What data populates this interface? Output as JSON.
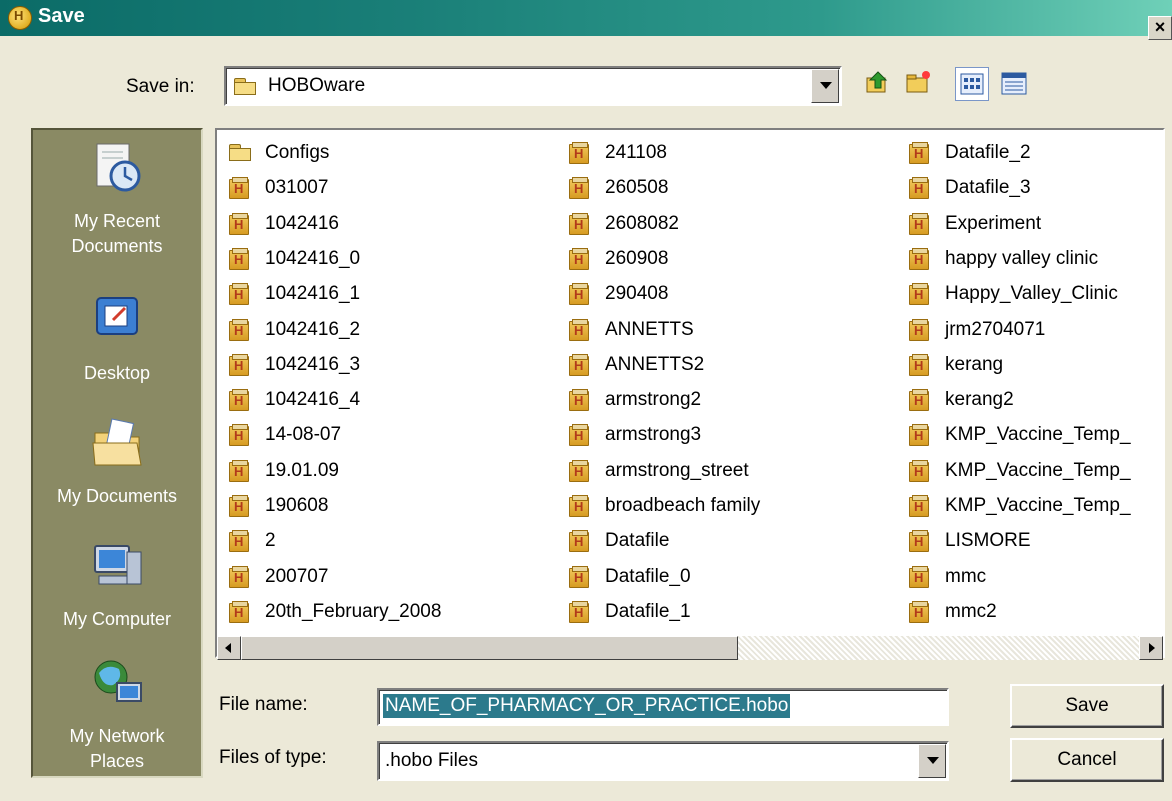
{
  "window": {
    "title": "Save",
    "close_label": "×"
  },
  "save_in": {
    "label": "Save in:",
    "value": "HOBOware"
  },
  "places": [
    {
      "label": "My Recent Documents",
      "line1": "My Recent",
      "line2": "Documents",
      "icon": "recent-documents-icon"
    },
    {
      "label": "Desktop",
      "line1": "Desktop",
      "line2": "",
      "icon": "desktop-icon"
    },
    {
      "label": "My Documents",
      "line1": "My Documents",
      "line2": "",
      "icon": "my-documents-icon"
    },
    {
      "label": "My Computer",
      "line1": "My Computer",
      "line2": "",
      "icon": "my-computer-icon"
    },
    {
      "label": "My Network Places",
      "line1": "My Network",
      "line2": "Places",
      "icon": "network-places-icon"
    }
  ],
  "files": {
    "col1": [
      "Configs",
      "031007",
      "1042416",
      "1042416_0",
      "1042416_1",
      "1042416_2",
      "1042416_3",
      "1042416_4",
      "14-08-07",
      "19.01.09",
      "190608",
      "2",
      "200707",
      "20th_February_2008"
    ],
    "col2": [
      "241108",
      "260508",
      "2608082",
      "260908",
      "290408",
      "ANNETTS",
      "ANNETTS2",
      "armstrong2",
      "armstrong3",
      "armstrong_street",
      "broadbeach family",
      "Datafile",
      "Datafile_0",
      "Datafile_1"
    ],
    "col3": [
      "Datafile_2",
      "Datafile_3",
      "Experiment",
      "happy valley clinic",
      "Happy_Valley_Clinic",
      "jrm2704071",
      "kerang",
      "kerang2",
      "KMP_Vaccine_Temp_",
      "KMP_Vaccine_Temp_",
      "KMP_Vaccine_Temp_",
      "LISMORE",
      "mmc",
      "mmc2"
    ]
  },
  "file_name": {
    "label": "File name:",
    "value": "NAME_OF_PHARMACY_OR_PRACTICE.hobo"
  },
  "file_type": {
    "label": "Files of type:",
    "value": ".hobo Files"
  },
  "buttons": {
    "save": "Save",
    "cancel": "Cancel"
  },
  "colors": {
    "title_start": "#0b6b67",
    "title_end": "#6fd0b8",
    "places_bg": "#8a8a64",
    "selection": "#2c7a8c"
  }
}
